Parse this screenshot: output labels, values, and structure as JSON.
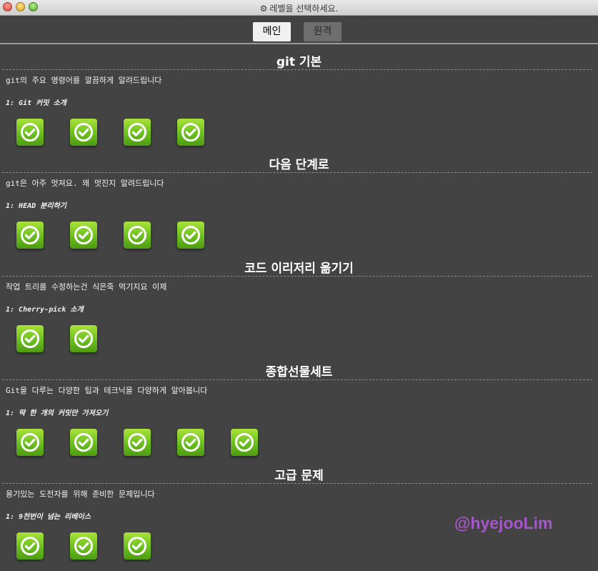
{
  "window": {
    "title": "레벨을 선택하세요."
  },
  "tabs": [
    {
      "label": "메인",
      "selected": true
    },
    {
      "label": "원격",
      "selected": false
    }
  ],
  "sections": [
    {
      "title": "git 기본",
      "description": "git의 주요 명령어를 깔끔하게 알려드립니다",
      "first_level": "1: Git 커밋 소개",
      "level_count": 4
    },
    {
      "title": "다음 단계로",
      "description": "git은 아주 멋져요. 왜 멋진지 알려드립니다",
      "first_level": "1: HEAD 분리하기",
      "level_count": 4
    },
    {
      "title": "코드 이리저리 옮기기",
      "description": "작업 트리를 수정하는건 식은죽 먹기지요 이제",
      "first_level": "1: Cherry-pick 소개",
      "level_count": 2
    },
    {
      "title": "종합선물세트",
      "description": "Git을 다루는 다양한 팁과 테크닉을 다양하게 알아봅니다",
      "first_level": "1: 딱 한 개의 커밋만 가져오기",
      "level_count": 5
    },
    {
      "title": "고급 문제",
      "description": "용기있는 도전자를 위해 준비한 문제입니다",
      "first_level": "1: 9천번이 넘는 리베이스",
      "level_count": 3
    }
  ],
  "watermark": "@hyejooLim",
  "colors": {
    "background": "#434343",
    "level_button": "#6bbf1f",
    "watermark": "#a457c7"
  },
  "icons": {
    "window_title": "gear-icon",
    "level": "check-circle-icon"
  }
}
